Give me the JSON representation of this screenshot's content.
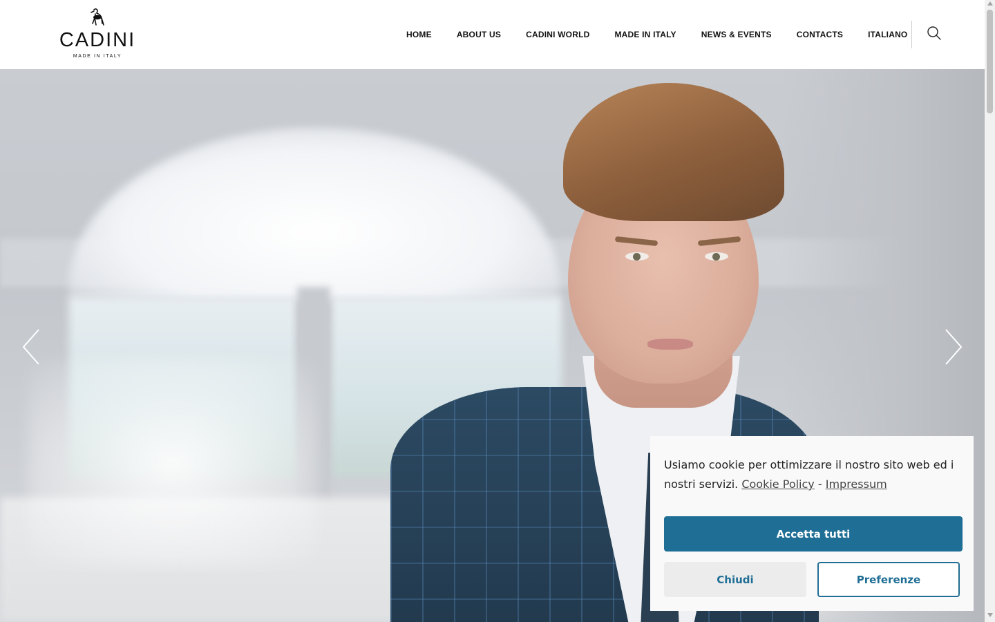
{
  "brand": {
    "name": "CADINI",
    "tagline": "MADE IN ITALY"
  },
  "nav": {
    "items": [
      {
        "label": "HOME"
      },
      {
        "label": "ABOUT US"
      },
      {
        "label": "CADINI WORLD"
      },
      {
        "label": "MADE IN ITALY"
      },
      {
        "label": "NEWS & EVENTS"
      },
      {
        "label": "CONTACTS"
      },
      {
        "label": "ITALIANO"
      }
    ],
    "search_icon": "search-icon"
  },
  "hero": {
    "prev_icon": "chevron-left-icon",
    "next_icon": "chevron-right-icon"
  },
  "cookie": {
    "message": "Usiamo cookie per ottimizzare il nostro sito web ed i nostri servizi.",
    "policy_link": "Cookie Policy",
    "separator": "-",
    "impressum_link": "Impressum",
    "accept_label": "Accetta tutti",
    "close_label": "Chiudi",
    "prefs_label": "Preferenze"
  },
  "colors": {
    "accent": "#1f6e95",
    "banner_bg": "#f9f9f9"
  }
}
